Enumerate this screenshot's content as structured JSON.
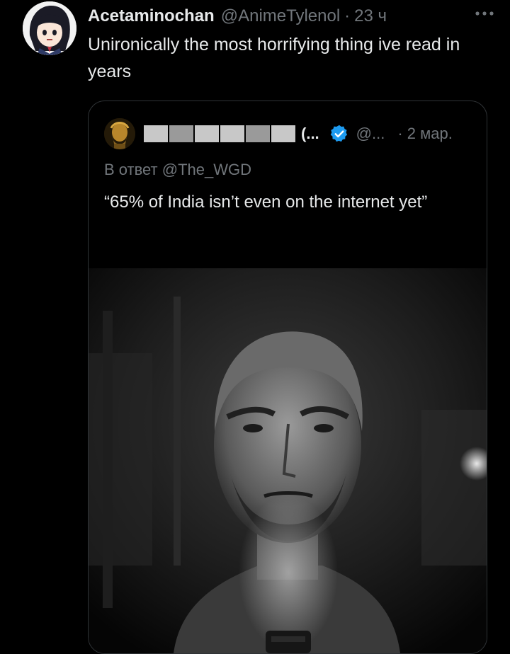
{
  "tweet": {
    "author_name": "Acetaminochan",
    "author_handle": "@AnimeTylenol",
    "time_sep": "·",
    "time": "23 ч",
    "text": "Unironically the most horrifying thing ive read in years"
  },
  "quote": {
    "author_name": "(...",
    "author_handle": "@...",
    "time": "· 2 мар.",
    "reply_to": "В ответ @The_WGD",
    "text": "“65% of India isn’t even on the internet yet”"
  },
  "icons": {
    "more": "more-horizontal-icon",
    "verified": "verified-badge-icon"
  },
  "colors": {
    "background": "#000000",
    "text_primary": "#e7e9ea",
    "text_secondary": "#71767b",
    "border": "#2f3336",
    "verified_blue": "#1d9bf0"
  }
}
